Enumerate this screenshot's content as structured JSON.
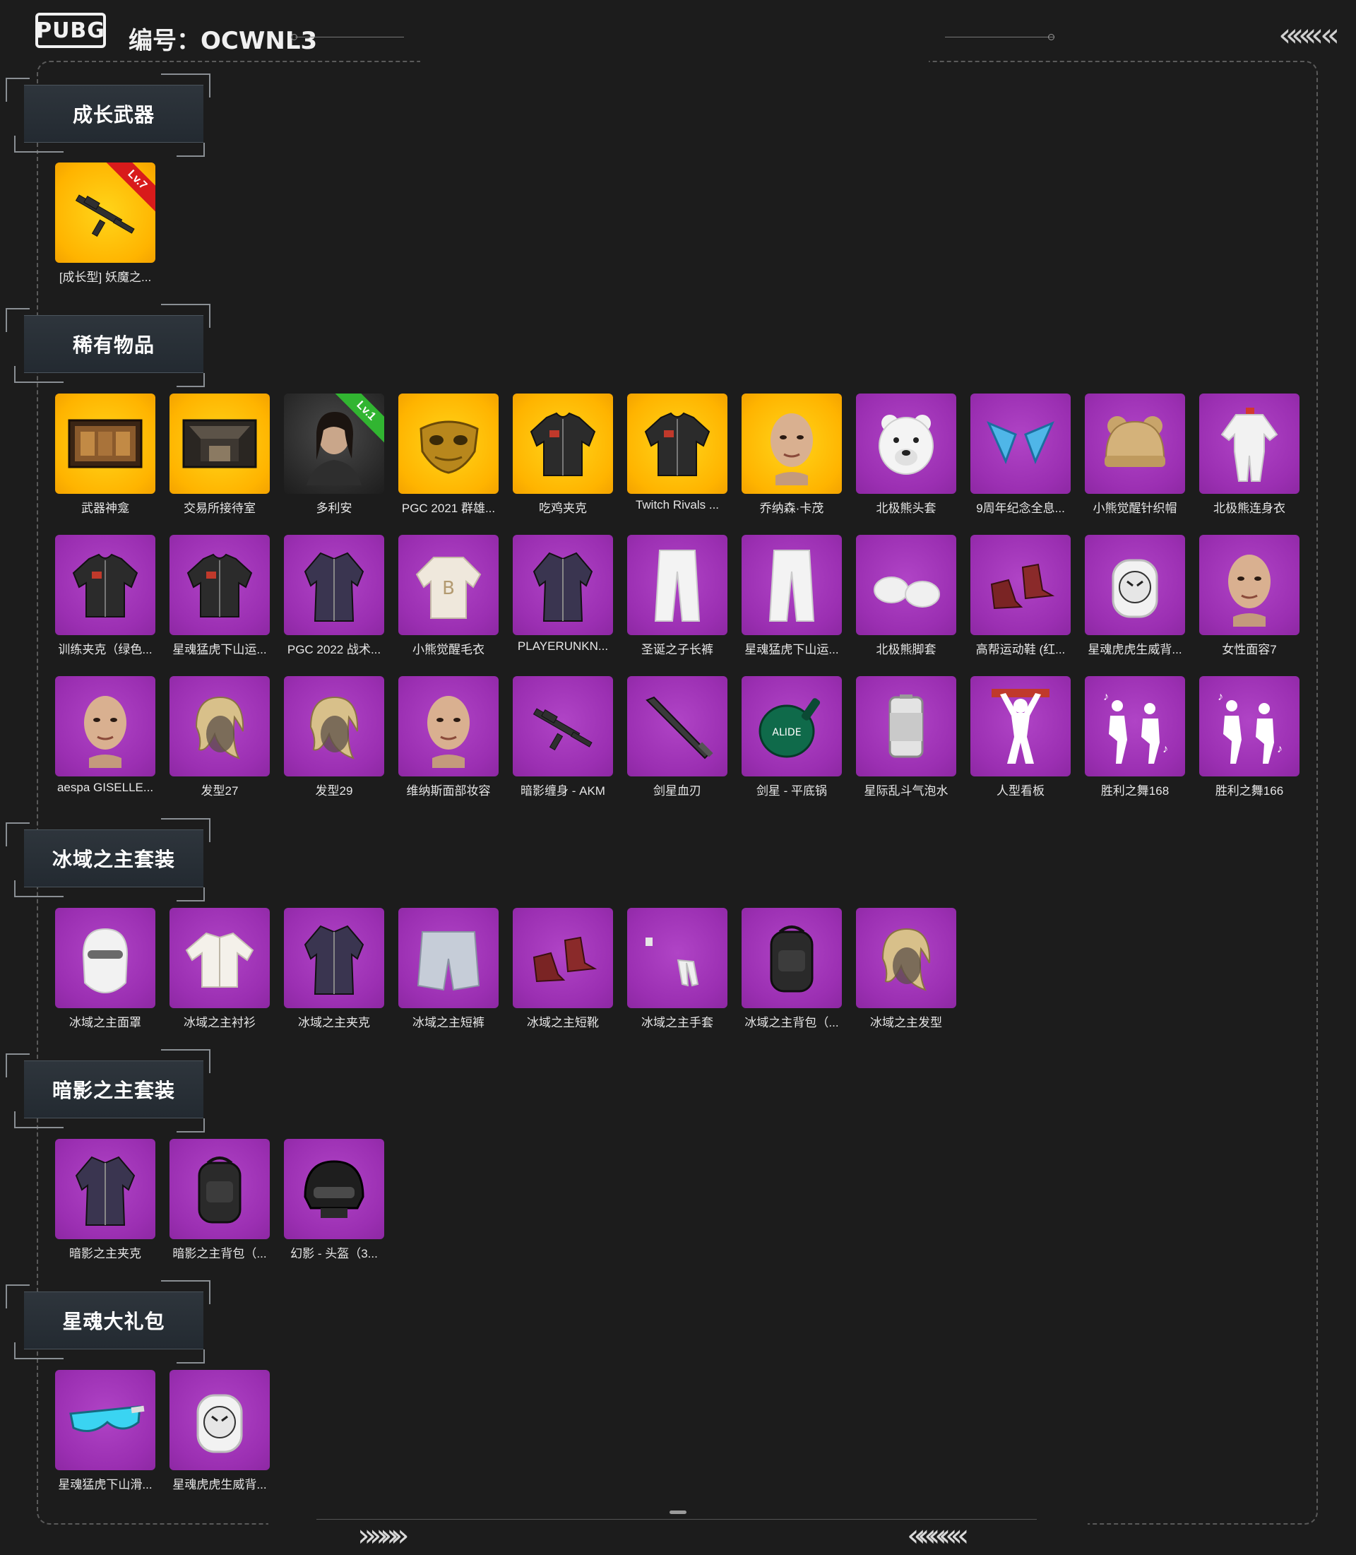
{
  "header": {
    "logo": "PUBG",
    "serial_prefix": "编号：",
    "serial_value": "OCWNL3",
    "nav_chevrons": "«««  «"
  },
  "footer": {
    "chevrons_left": "» »»»",
    "chevrons_right": "«««« «"
  },
  "sections": [
    {
      "title": "成长武器",
      "items": [
        {
          "label": "[成长型] 妖魔之...",
          "bg": "gold",
          "icon": "rifle-icon",
          "badge": "Lv.7",
          "badge_color": "red"
        }
      ]
    },
    {
      "title": "稀有物品",
      "items": [
        {
          "label": "武器神龛",
          "bg": "gold",
          "icon": "shrine-icon"
        },
        {
          "label": "交易所接待室",
          "bg": "gold",
          "icon": "room-icon"
        },
        {
          "label": "多利安",
          "bg": "dark",
          "icon": "character-portrait-icon",
          "badge": "Lv.1",
          "badge_color": "green"
        },
        {
          "label": "PGC 2021 群雄...",
          "bg": "gold",
          "icon": "gold-mask-icon"
        },
        {
          "label": "吃鸡夹克",
          "bg": "gold",
          "icon": "jacket-icon"
        },
        {
          "label": "Twitch Rivals ...",
          "bg": "gold",
          "icon": "jacket-icon"
        },
        {
          "label": "乔纳森·卡茂",
          "bg": "gold",
          "icon": "face-icon"
        },
        {
          "label": "北极熊头套",
          "bg": "purple",
          "icon": "bear-head-icon"
        },
        {
          "label": "9周年纪念全息...",
          "bg": "purple",
          "icon": "ears-icon"
        },
        {
          "label": "小熊觉醒针织帽",
          "bg": "purple",
          "icon": "beanie-icon"
        },
        {
          "label": "北极熊连身衣",
          "bg": "purple",
          "icon": "jumpsuit-icon"
        },
        {
          "label": "训练夹克（绿色...",
          "bg": "purple",
          "icon": "jacket-icon"
        },
        {
          "label": "星魂猛虎下山运...",
          "bg": "purple",
          "icon": "jacket-icon"
        },
        {
          "label": "PGC 2022 战术...",
          "bg": "purple",
          "icon": "coat-icon"
        },
        {
          "label": "小熊觉醒毛衣",
          "bg": "purple",
          "icon": "sweater-icon"
        },
        {
          "label": "PLAYERUNKN...",
          "bg": "purple",
          "icon": "coat-icon"
        },
        {
          "label": "圣诞之子长裤",
          "bg": "purple",
          "icon": "pants-icon"
        },
        {
          "label": "星魂猛虎下山运...",
          "bg": "purple",
          "icon": "pants-icon"
        },
        {
          "label": "北极熊脚套",
          "bg": "purple",
          "icon": "paws-icon"
        },
        {
          "label": "高帮运动鞋 (红...",
          "bg": "purple",
          "icon": "shoes-icon"
        },
        {
          "label": "星魂虎虎生威背...",
          "bg": "purple",
          "icon": "tiger-backpack-icon"
        },
        {
          "label": "女性面容7",
          "bg": "purple",
          "icon": "face-icon"
        },
        {
          "label": "aespa GISELLE...",
          "bg": "purple",
          "icon": "face-icon"
        },
        {
          "label": "发型27",
          "bg": "purple",
          "icon": "hair-icon"
        },
        {
          "label": "发型29",
          "bg": "purple",
          "icon": "hair-icon"
        },
        {
          "label": "维纳斯面部妆容",
          "bg": "purple",
          "icon": "face-icon"
        },
        {
          "label": "暗影缠身 - AKM",
          "bg": "purple",
          "icon": "rifle-icon"
        },
        {
          "label": "剑星血刃",
          "bg": "purple",
          "icon": "blade-icon"
        },
        {
          "label": "剑星 - 平底锅",
          "bg": "purple",
          "icon": "pan-icon"
        },
        {
          "label": "星际乱斗气泡水",
          "bg": "purple",
          "icon": "can-icon"
        },
        {
          "label": "人型看板",
          "bg": "purple",
          "icon": "figure-icon"
        },
        {
          "label": "胜利之舞168",
          "bg": "purple",
          "icon": "dance-icon"
        },
        {
          "label": "胜利之舞166",
          "bg": "purple",
          "icon": "dance-icon"
        }
      ]
    },
    {
      "title": "冰域之主套装",
      "items": [
        {
          "label": "冰域之主面罩",
          "bg": "purple",
          "icon": "mask-icon"
        },
        {
          "label": "冰域之主衬衫",
          "bg": "purple",
          "icon": "shirt-icon"
        },
        {
          "label": "冰域之主夹克",
          "bg": "purple",
          "icon": "coat-icon"
        },
        {
          "label": "冰域之主短裤",
          "bg": "purple",
          "icon": "shorts-icon"
        },
        {
          "label": "冰域之主短靴",
          "bg": "purple",
          "icon": "shoes-icon"
        },
        {
          "label": "冰域之主手套",
          "bg": "purple",
          "icon": "gloves-icon"
        },
        {
          "label": "冰域之主背包（...",
          "bg": "purple",
          "icon": "backpack-icon"
        },
        {
          "label": "冰域之主发型",
          "bg": "purple",
          "icon": "hair-icon"
        }
      ]
    },
    {
      "title": "暗影之主套装",
      "items": [
        {
          "label": "暗影之主夹克",
          "bg": "purple",
          "icon": "coat-icon"
        },
        {
          "label": "暗影之主背包（...",
          "bg": "purple",
          "icon": "backpack-icon"
        },
        {
          "label": "幻影 - 头盔（3...",
          "bg": "purple",
          "icon": "helmet-icon"
        }
      ]
    },
    {
      "title": "星魂大礼包",
      "items": [
        {
          "label": "星魂猛虎下山滑...",
          "bg": "purple",
          "icon": "goggles-icon"
        },
        {
          "label": "星魂虎虎生威背...",
          "bg": "purple",
          "icon": "tiger-backpack-icon"
        }
      ]
    }
  ]
}
